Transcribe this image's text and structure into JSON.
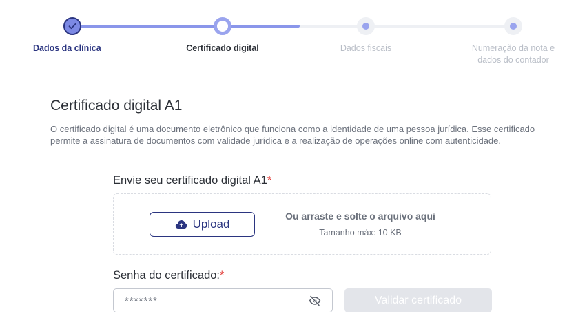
{
  "stepper": {
    "steps": [
      {
        "label": "Dados da clínica",
        "state": "done"
      },
      {
        "label": "Certificado digital",
        "state": "current"
      },
      {
        "label": "Dados fiscais",
        "state": "todo"
      },
      {
        "label": "Numeração da nota e dados do contador",
        "state": "todo"
      }
    ],
    "progress": 0.5,
    "colors": {
      "active": "#2b3580",
      "done_track": "#8a96ea",
      "pending": "#b9bec7"
    }
  },
  "section": {
    "title": "Certificado digital A1",
    "description": "O certificado digital é uma documento eletrônico que funciona como a identidade de uma pessoa jurídica. Esse certificado permite a assinatura de documentos com validade jurídica e a realização de operações online com autenticidade."
  },
  "upload": {
    "label": "Envie seu certificado digital A1",
    "required_mark": "*",
    "button_label": "Upload",
    "button_icon": "cloud-upload-icon",
    "drop_text": "Ou arraste e solte o arquivo aqui",
    "max_size": "Tamanho máx: 10 KB"
  },
  "password": {
    "label": "Senha do certificado:",
    "required_mark": "*",
    "value": "*******",
    "toggle_icon": "eye-off-icon"
  },
  "actions": {
    "validate_label": "Validar certificado",
    "validate_disabled": true
  }
}
